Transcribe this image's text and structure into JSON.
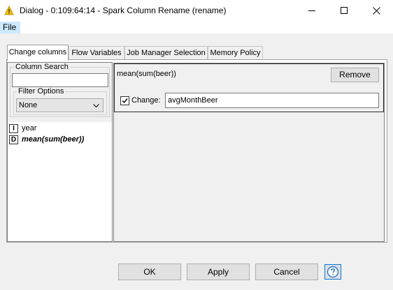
{
  "window": {
    "title": "Dialog - 0:109:64:14 - Spark Column Rename (rename)",
    "icon": "warning-triangle-icon",
    "controls": [
      "minimize-icon",
      "maximize-icon",
      "close-icon"
    ]
  },
  "menu": {
    "file_label": "File"
  },
  "tabs": [
    {
      "label": "Change columns",
      "active": true
    },
    {
      "label": "Flow Variables"
    },
    {
      "label": "Job Manager Selection"
    },
    {
      "label": "Memory Policy"
    }
  ],
  "left_panel": {
    "search_label": "Column Search",
    "search_value": "",
    "filter_label": "Filter Options",
    "filter_selected": "None"
  },
  "columns": [
    {
      "type": "I",
      "name": "year",
      "emphasized": false
    },
    {
      "type": "D",
      "name": "mean(sum(beer))",
      "emphasized": true
    }
  ],
  "rename": {
    "column": "mean(sum(beer))",
    "remove_label": "Remove",
    "change_label": "Change:",
    "change_checked": true,
    "new_name": "avgMonthBeer"
  },
  "buttons": {
    "ok": "OK",
    "apply": "Apply",
    "cancel": "Cancel"
  },
  "help_icon": "help-question-icon",
  "colors": {
    "accent": "#0078d7",
    "menu_highlight": "#cce8ff",
    "warning": "#f5c211"
  }
}
